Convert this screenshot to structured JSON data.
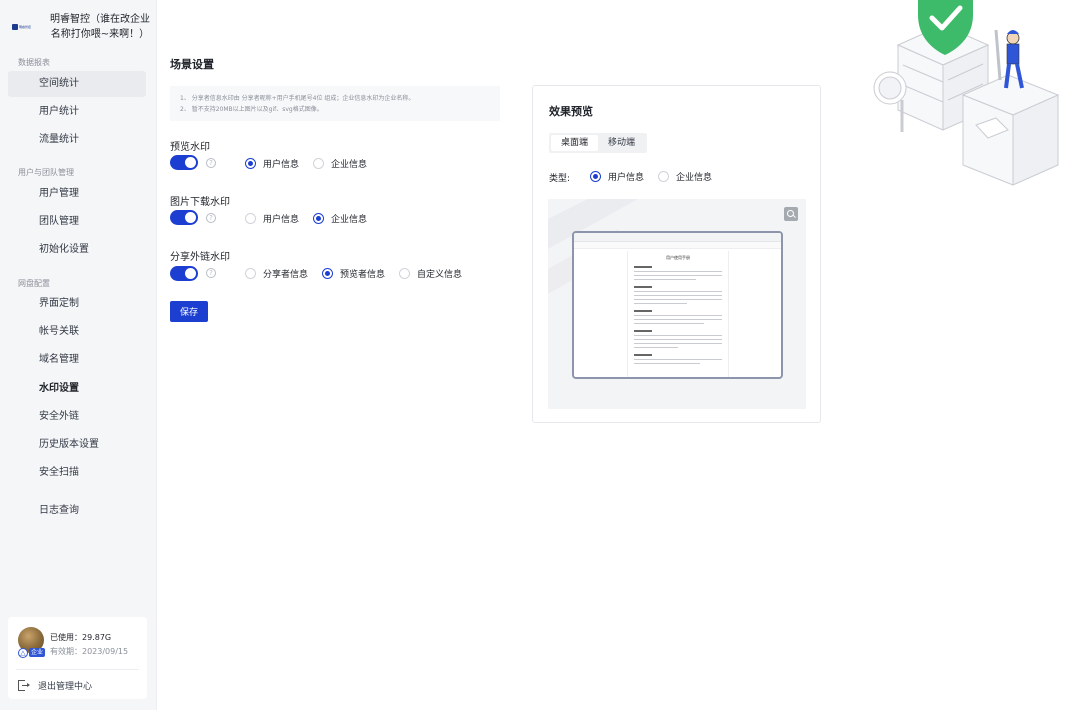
{
  "brand": {
    "logo_text": "明睿智控",
    "name": "明睿智控（谁在改企业名称打你喂~来啊！）"
  },
  "sidebar": {
    "groups": [
      {
        "title": "数据报表",
        "items": [
          "空间统计",
          "用户统计",
          "流量统计"
        ]
      },
      {
        "title": "用户与团队管理",
        "items": [
          "用户管理",
          "团队管理",
          "初始化设置"
        ]
      },
      {
        "title": "网盘配置",
        "items": [
          "界面定制",
          "帐号关联",
          "域名管理",
          "水印设置",
          "安全外链",
          "历史版本设置",
          "安全扫描",
          "日志查询"
        ]
      }
    ]
  },
  "user": {
    "badge": "企业",
    "used_label": "已使用：",
    "used_value": "29.87G",
    "expire_label": "有效期：",
    "expire_value": "2023/09/15",
    "logout_label": "退出管理中心"
  },
  "main": {
    "title": "场景设置",
    "notice": [
      "1、 分享者信息水印由 分享者昵称+用户手机尾号4位 组成；企业信息水印为企业名称。",
      "2、 暂不支持20MB以上图片以及gif、svg格式图像。"
    ],
    "sections": [
      {
        "label": "预览水印",
        "enabled": true,
        "options": [
          "用户信息",
          "企业信息"
        ],
        "selected": 0
      },
      {
        "label": "图片下载水印",
        "enabled": true,
        "options": [
          "用户信息",
          "企业信息"
        ],
        "selected": 1
      },
      {
        "label": "分享外链水印",
        "enabled": true,
        "options": [
          "分享者信息",
          "预览者信息",
          "自定义信息"
        ],
        "selected": 1
      }
    ],
    "help_glyph": "?",
    "save_label": "保存"
  },
  "preview": {
    "title": "效果预览",
    "tabs": [
      "桌面端",
      "移动端"
    ],
    "active_tab": 0,
    "type_label": "类型:",
    "type_options": [
      "用户信息",
      "企业信息"
    ],
    "type_selected": 0,
    "doc_title": "用户使用手册"
  },
  "colors": {
    "primary": "#1d3fd1",
    "sidebar_bg": "#f5f6f8",
    "shield": "#3dbb6a"
  }
}
